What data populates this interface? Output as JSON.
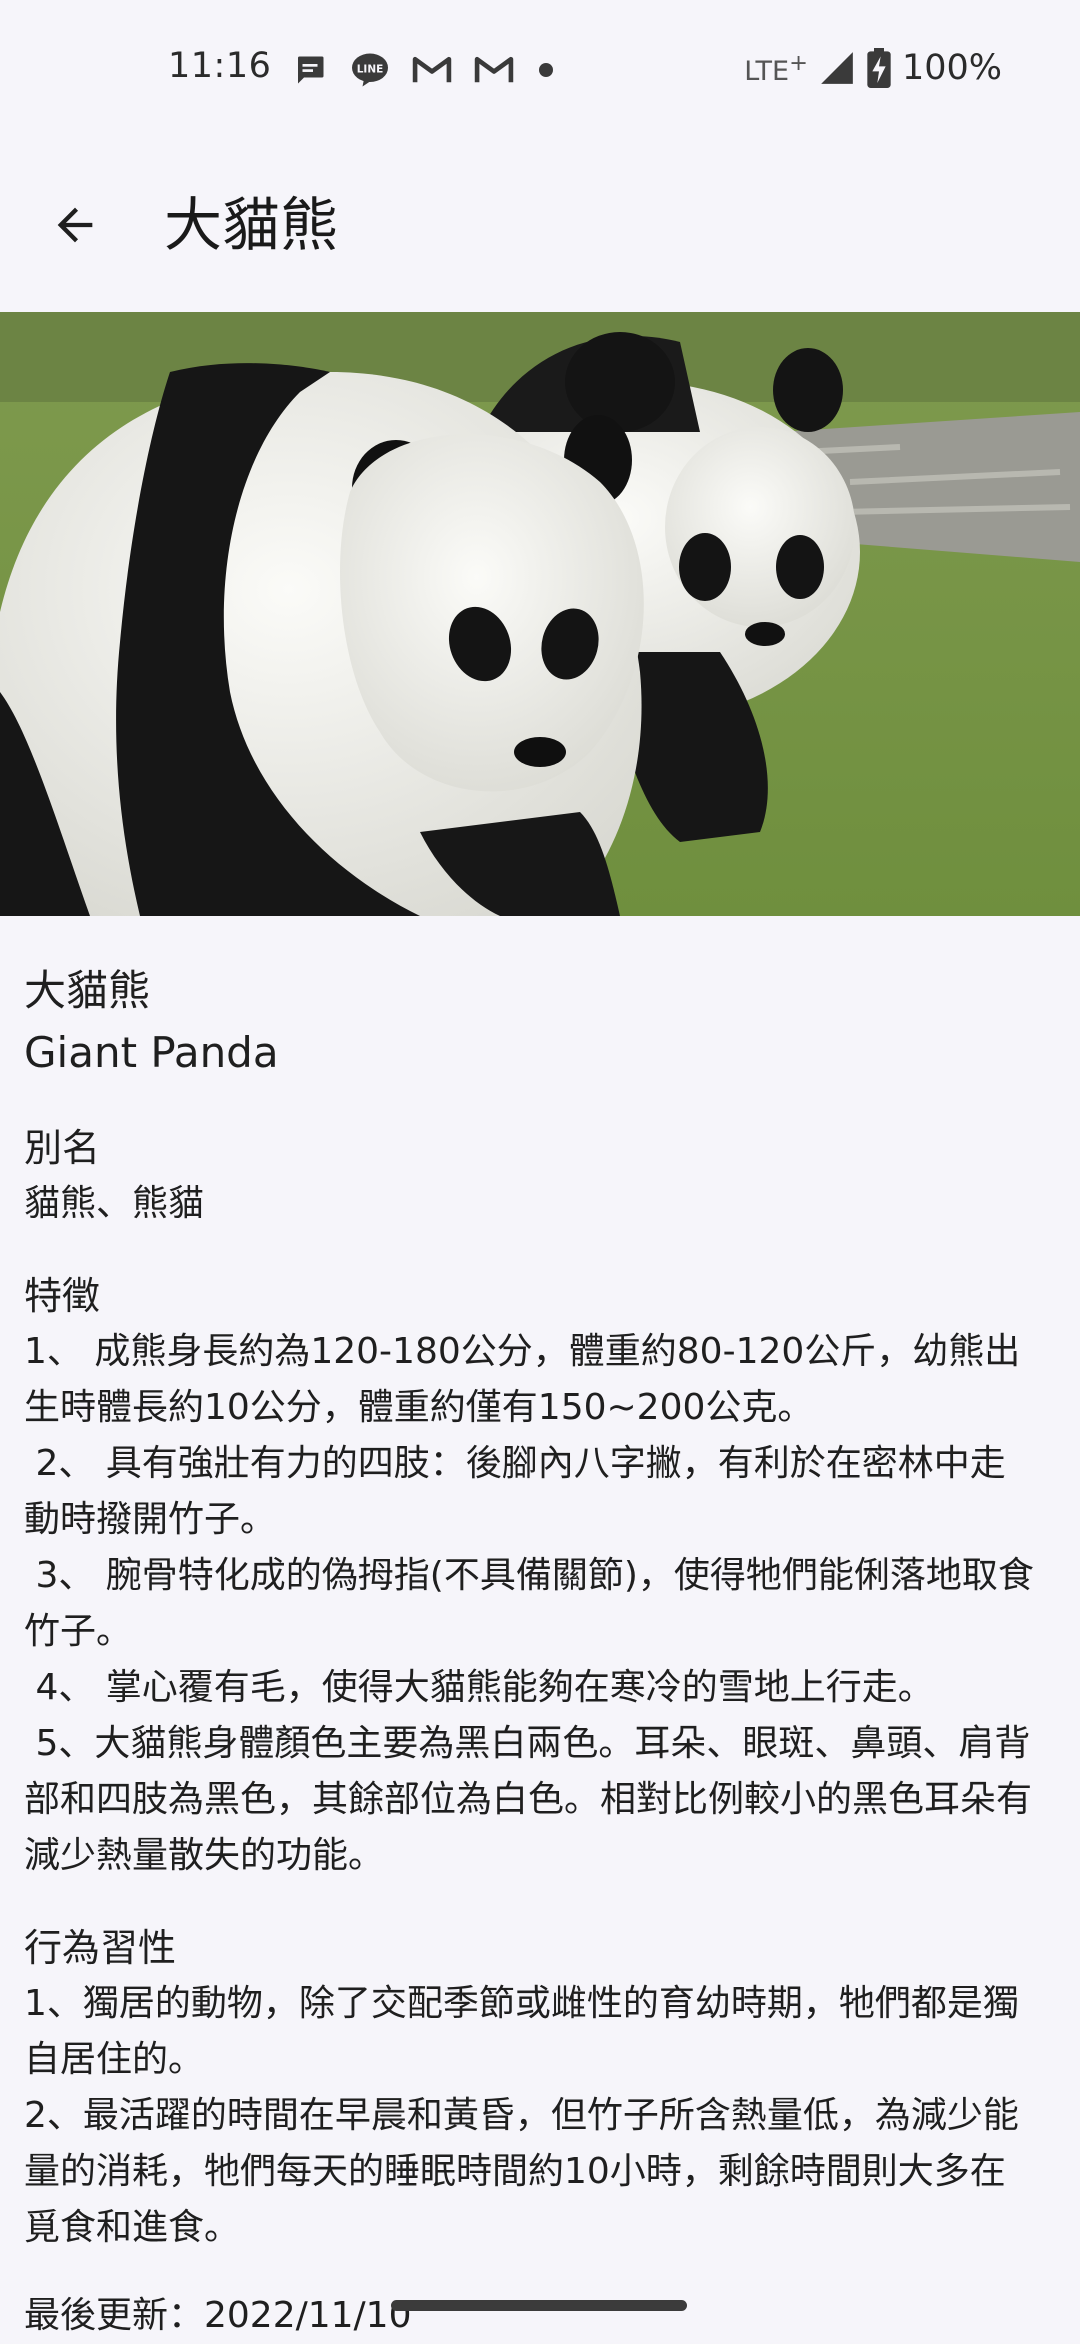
{
  "status_bar": {
    "time": "11:16",
    "network": "LTE",
    "network_plus": "+",
    "battery": "100%",
    "notification_icons": [
      "message-icon",
      "line-icon",
      "gmail-icon",
      "gmail-icon",
      "dot-icon"
    ]
  },
  "app_bar": {
    "title": "大貓熊"
  },
  "animal": {
    "name_zh": "大貓熊",
    "name_en": "Giant Panda",
    "image_alt_icon": "panda-photo"
  },
  "sections": {
    "alias": {
      "title": "別名",
      "body": "貓熊、熊貓"
    },
    "features": {
      "title": "特徵",
      "body": "1、 成熊身長約為120-180公分，體重約80-120公斤，幼熊出生時體長約10公分，體重約僅有150~200公克。\n 2、 具有強壯有力的四肢：後腳內八字撇，有利於在密林中走動時撥開竹子。\n 3、 腕骨特化成的偽拇指(不具備關節)，使得牠們能俐落地取食竹子。\n 4、 掌心覆有毛，使得大貓熊能夠在寒冷的雪地上行走。\n 5、大貓熊身體顏色主要為黑白兩色。耳朵、眼斑、鼻頭、肩背部和四肢為黑色，其餘部位為白色。相對比例較小的黑色耳朵有減少熱量散失的功能。"
    },
    "behavior": {
      "title": "行為習性",
      "body": "1、獨居的動物，除了交配季節或雌性的育幼時期，牠們都是獨自居住的。\n2、最活躍的時間在早晨和黃昏，但竹子所含熱量低，為減少能量的消耗，牠們每天的睡眠時間約10小時，剩餘時間則大多在覓食和進食。"
    }
  },
  "last_updated": "最後更新：2022/11/10",
  "colors": {
    "background": "#f6f5fa",
    "text": "#1f1f1f"
  }
}
